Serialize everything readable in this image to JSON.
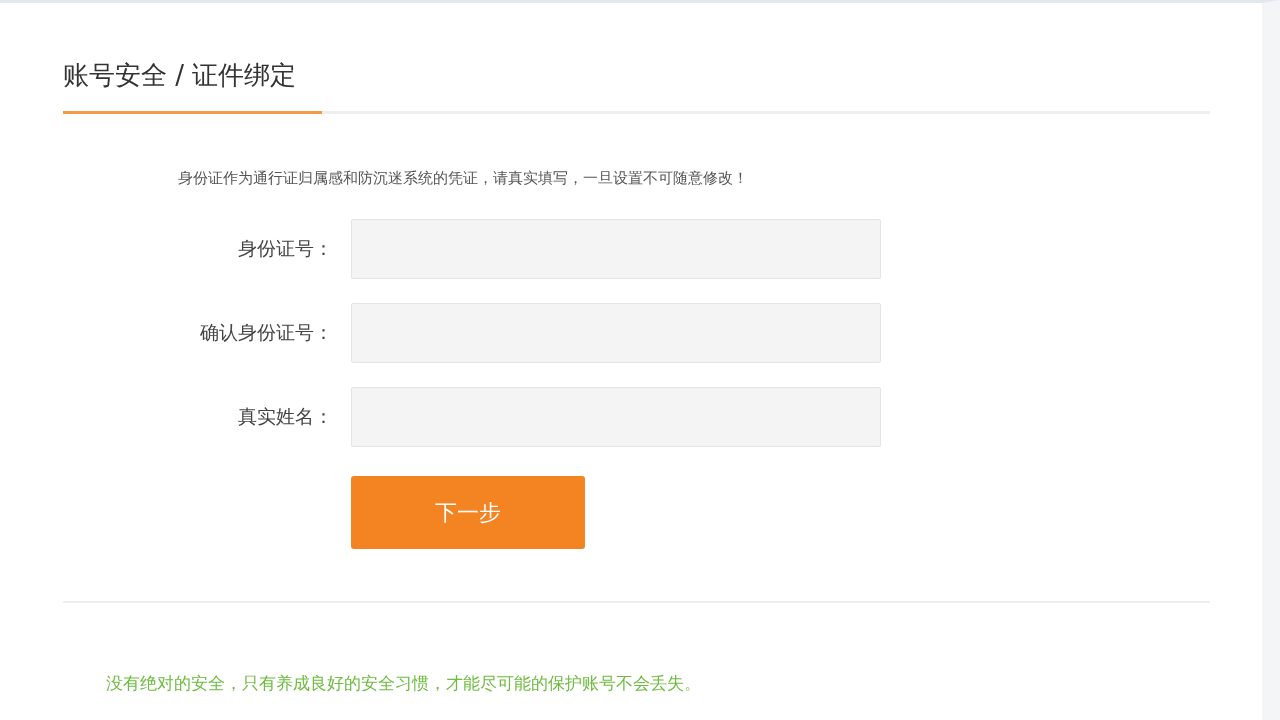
{
  "page": {
    "title": "账号安全 / 证件绑定"
  },
  "notice": "身份证作为通行证归属感和防沉迷系统的凭证，请真实填写，一旦设置不可随意修改！",
  "fields": [
    {
      "label": "身份证号："
    },
    {
      "label": "确认身份证号："
    },
    {
      "label": "真实姓名："
    }
  ],
  "buttons": [
    "下一步"
  ],
  "tip": "没有绝对的安全，只有养成良好的安全习惯，才能尽可能的保护账号不会丢失。"
}
